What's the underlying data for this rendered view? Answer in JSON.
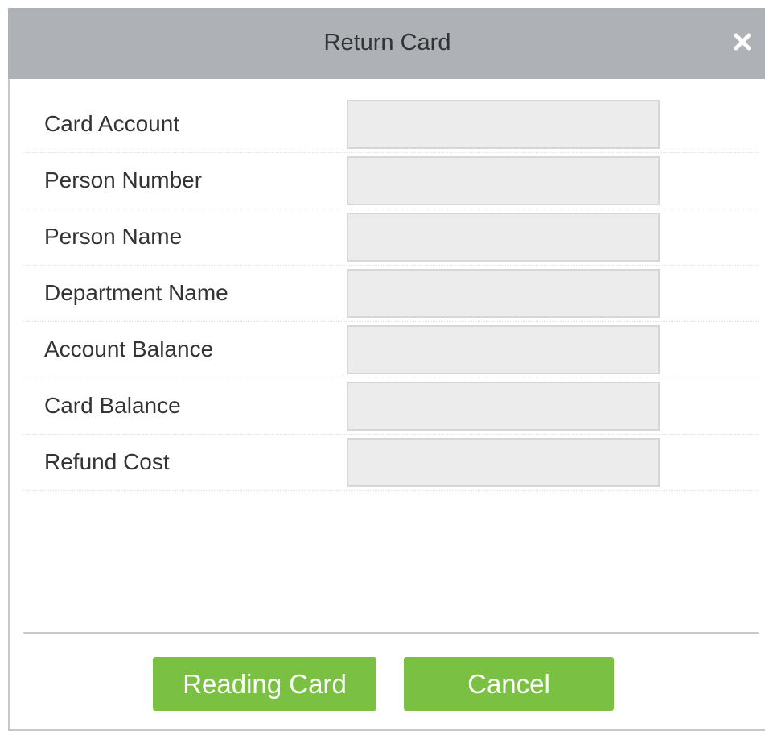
{
  "dialog": {
    "title": "Return Card",
    "close_icon": "close-icon"
  },
  "fields": [
    {
      "label": "Card Account",
      "value": ""
    },
    {
      "label": "Person Number",
      "value": ""
    },
    {
      "label": "Person Name",
      "value": ""
    },
    {
      "label": "Department Name",
      "value": ""
    },
    {
      "label": "Account Balance",
      "value": ""
    },
    {
      "label": "Card Balance",
      "value": ""
    },
    {
      "label": "Refund Cost",
      "value": ""
    }
  ],
  "buttons": {
    "reading_card": "Reading Card",
    "cancel": "Cancel"
  },
  "colors": {
    "titlebar": "#aeb1b5",
    "button": "#7ac143",
    "field_background": "#ececec"
  }
}
